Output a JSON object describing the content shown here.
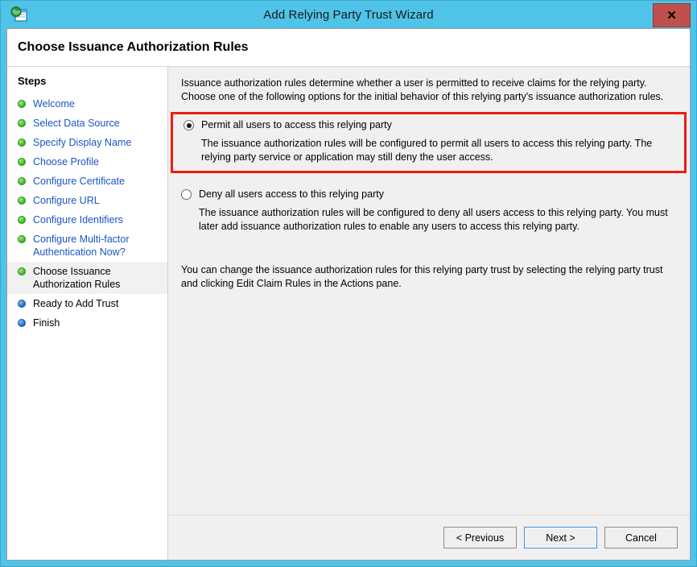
{
  "window": {
    "title": "Add Relying Party Trust Wizard",
    "icon": "adfs-wizard-icon",
    "close_label": "✕"
  },
  "page": {
    "heading": "Choose Issuance Authorization Rules"
  },
  "sidebar": {
    "title": "Steps",
    "items": [
      {
        "label": "Welcome",
        "state": "done"
      },
      {
        "label": "Select Data Source",
        "state": "done"
      },
      {
        "label": "Specify Display Name",
        "state": "done"
      },
      {
        "label": "Choose Profile",
        "state": "done"
      },
      {
        "label": "Configure Certificate",
        "state": "done"
      },
      {
        "label": "Configure URL",
        "state": "done"
      },
      {
        "label": "Configure Identifiers",
        "state": "done"
      },
      {
        "label": "Configure Multi-factor Authentication Now?",
        "state": "done"
      },
      {
        "label": "Choose Issuance Authorization Rules",
        "state": "current"
      },
      {
        "label": "Ready to Add Trust",
        "state": "pending"
      },
      {
        "label": "Finish",
        "state": "pending"
      }
    ]
  },
  "content": {
    "intro": "Issuance authorization rules determine whether a user is permitted to receive claims for the relying party. Choose one of the following options for the initial behavior of this relying party's issuance authorization rules.",
    "options": [
      {
        "label": "Permit all users to access this relying party",
        "description": "The issuance authorization rules will be configured to permit all users to access this relying party. The relying party service or application may still deny the user access.",
        "selected": true
      },
      {
        "label": "Deny all users access to this relying party",
        "description": "The issuance authorization rules will be configured to deny all users access to this relying party. You must later add issuance authorization rules to enable any users to access this relying party.",
        "selected": false
      }
    ],
    "note": "You can change the issuance authorization rules for this relying party trust by selecting the relying party trust and clicking Edit Claim Rules in the Actions pane."
  },
  "buttons": {
    "previous": "< Previous",
    "next": "Next >",
    "cancel": "Cancel"
  },
  "colors": {
    "frame": "#4FC3E8",
    "annotation": "#EE1C11",
    "link": "#1B55C4",
    "step_done": "#41BE26",
    "step_pending": "#2272CE",
    "close_button": "#C0504D",
    "panel": "#F0F0F0"
  }
}
